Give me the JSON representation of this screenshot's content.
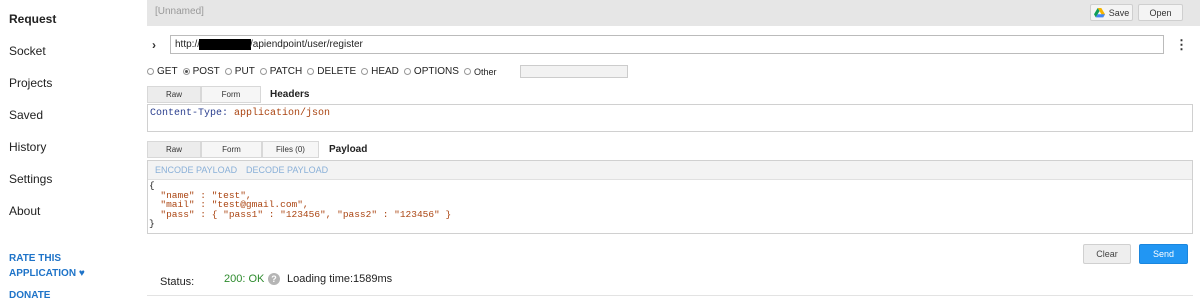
{
  "sidebar": {
    "items": [
      {
        "label": "Request",
        "active": true
      },
      {
        "label": "Socket"
      },
      {
        "label": "Projects"
      },
      {
        "label": "Saved"
      },
      {
        "label": "History"
      },
      {
        "label": "Settings"
      },
      {
        "label": "About"
      }
    ],
    "rate_line1": "RATE THIS",
    "rate_line2": "APPLICATION ♥",
    "donate": "DONATE"
  },
  "request": {
    "name": "[Unnamed]",
    "save_label": "Save",
    "open_label": "Open",
    "url_prefix": "http://",
    "url_suffix": "/apiendpoint/user/register",
    "methods": [
      {
        "label": "GET",
        "checked": false
      },
      {
        "label": "POST",
        "checked": true
      },
      {
        "label": "PUT",
        "checked": false
      },
      {
        "label": "PATCH",
        "checked": false
      },
      {
        "label": "DELETE",
        "checked": false
      },
      {
        "label": "HEAD",
        "checked": false
      },
      {
        "label": "OPTIONS",
        "checked": false
      },
      {
        "label": "Other",
        "checked": false
      }
    ]
  },
  "headers": {
    "tabs": [
      "Raw",
      "Form"
    ],
    "title": "Headers",
    "key": "Content-Type:",
    "value": "application/json"
  },
  "payload": {
    "tabs": [
      "Raw",
      "Form",
      "Files (0)"
    ],
    "title": "Payload",
    "encode": "ENCODE PAYLOAD",
    "decode": "DECODE PAYLOAD",
    "lines": [
      "{",
      "  \"name\" : \"test\",",
      "  \"mail\" : \"test@gmail.com\",",
      "  \"pass\" : { \"pass1\" : \"123456\", \"pass2\" : \"123456\" }",
      "}"
    ]
  },
  "actions": {
    "clear_label": "Clear",
    "send_label": "Send"
  },
  "status": {
    "label": "Status:",
    "code": "200: OK",
    "help": "?",
    "loading": "Loading time:1589ms"
  },
  "colors": {
    "accent": "#2196f3",
    "link": "#1e73c8",
    "ok": "#2e8b2e"
  }
}
